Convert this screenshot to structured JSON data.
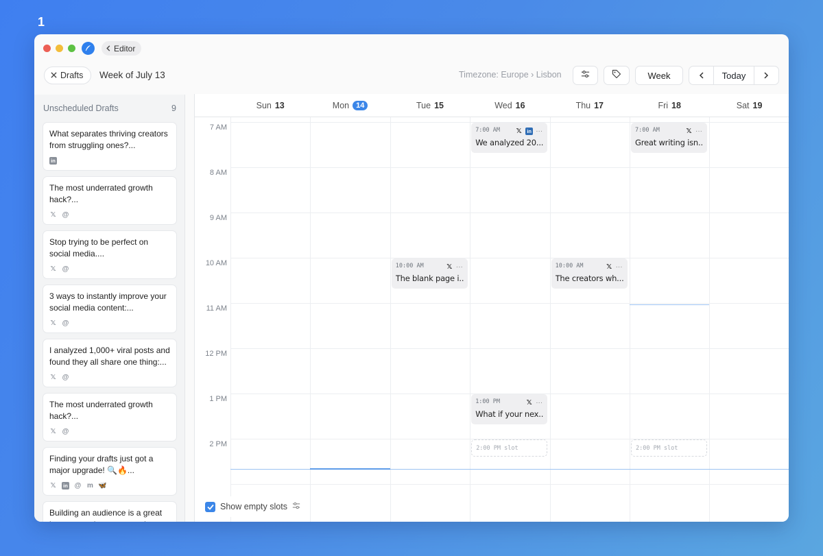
{
  "step_number": "1",
  "titlebar": {
    "back_label": "Editor"
  },
  "toolbar": {
    "drafts_label": "Drafts",
    "week_title": "Week of July 13",
    "timezone": "Timezone: Europe › Lisbon",
    "view_label": "Week",
    "today_label": "Today"
  },
  "sidebar": {
    "title": "Unscheduled Drafts",
    "count": "9",
    "drafts": [
      {
        "text": "What separates thriving creators from struggling ones?...",
        "platforms": [
          "linkedin"
        ]
      },
      {
        "text": "The most underrated growth hack?...",
        "platforms": [
          "x",
          "threads"
        ]
      },
      {
        "text": "Stop trying to be perfect on social media....",
        "platforms": [
          "x",
          "threads"
        ]
      },
      {
        "text": "3 ways to instantly improve your social media content:...",
        "platforms": [
          "x",
          "threads"
        ]
      },
      {
        "text": "I analyzed 1,000+ viral posts and found they all share one thing:...",
        "platforms": [
          "x",
          "threads"
        ]
      },
      {
        "text": "The most underrated growth hack?...",
        "platforms": [
          "x",
          "threads"
        ]
      },
      {
        "text": "Finding your drafts just got a major upgrade! 🔍🔥...",
        "platforms": [
          "x",
          "linkedin",
          "threads",
          "mastodon",
          "bluesky"
        ]
      },
      {
        "text": "Building an audience is a great investment that compounds",
        "platforms": []
      }
    ]
  },
  "calendar": {
    "days": [
      {
        "name": "Sun",
        "num": "13"
      },
      {
        "name": "Mon",
        "num": "14",
        "today": true
      },
      {
        "name": "Tue",
        "num": "15"
      },
      {
        "name": "Wed",
        "num": "16"
      },
      {
        "name": "Thu",
        "num": "17"
      },
      {
        "name": "Fri",
        "num": "18"
      },
      {
        "name": "Sat",
        "num": "19"
      }
    ],
    "hours": [
      "7 AM",
      "8 AM",
      "9 AM",
      "10 AM",
      "11 AM",
      "12 PM",
      "1 PM",
      "2 PM"
    ],
    "events": [
      {
        "day": 3,
        "hour": 7,
        "time": "7:00 AM",
        "text": "We analyzed 20...",
        "platforms": [
          "x",
          "linkedin"
        ]
      },
      {
        "day": 5,
        "hour": 7,
        "time": "7:00 AM",
        "text": "Great writing isn...",
        "platforms": [
          "x"
        ]
      },
      {
        "day": 2,
        "hour": 10,
        "time": "10:00 AM",
        "text": "The blank page i...",
        "platforms": [
          "x"
        ]
      },
      {
        "day": 4,
        "hour": 10,
        "time": "10:00 AM",
        "text": "The creators wh...",
        "platforms": [
          "x"
        ]
      },
      {
        "day": 3,
        "hour": 13,
        "time": "1:00 PM",
        "text": "What if your nex...",
        "platforms": [
          "x"
        ]
      }
    ],
    "slots": [
      {
        "day": 3,
        "hour": 14,
        "label": "2:00 PM slot"
      },
      {
        "day": 5,
        "hour": 14,
        "label": "2:00 PM slot"
      }
    ],
    "show_empty_slots_label": "Show empty slots",
    "show_empty_slots_checked": true,
    "accent_color": "#3b86e8"
  }
}
